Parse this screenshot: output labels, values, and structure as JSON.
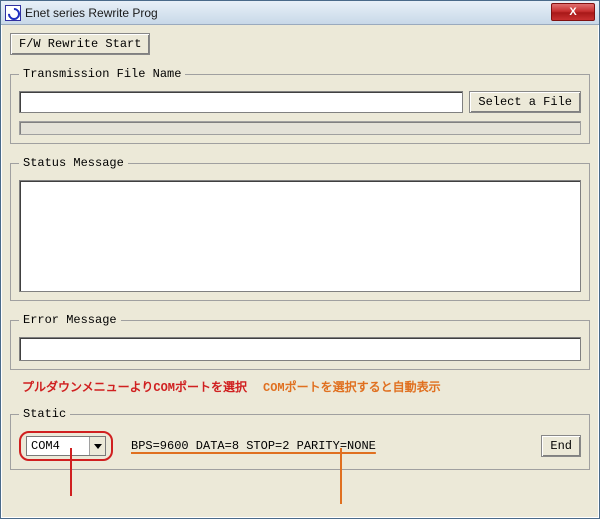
{
  "titlebar": {
    "title": "Enet series Rewrite Prog",
    "close": "X"
  },
  "toolbar": {
    "rewrite_start": "F/W Rewrite Start"
  },
  "groups": {
    "transmission": {
      "legend": "Transmission File Name",
      "select_file": "Select a File",
      "filename": ""
    },
    "status": {
      "legend": "Status Message",
      "text": ""
    },
    "error": {
      "legend": "Error Message",
      "text": ""
    },
    "static": {
      "legend": "Static",
      "com_value": "COM4",
      "serial_settings": "BPS=9600  DATA=8  STOP=2  PARITY=NONE",
      "end": "End"
    }
  },
  "annotations": {
    "red": "プルダウンメニューよりCOMポートを選択",
    "orange": "COMポートを選択すると自動表示"
  }
}
